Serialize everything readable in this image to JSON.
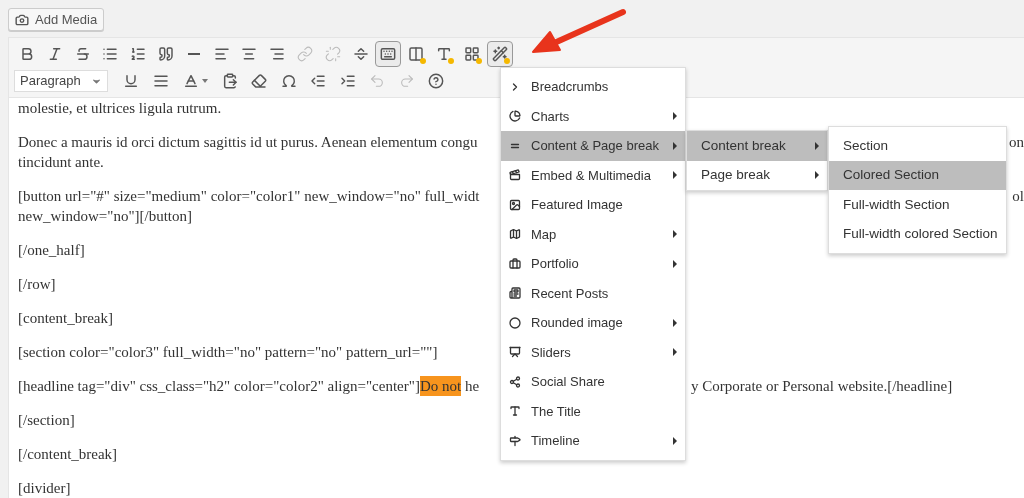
{
  "add_media": {
    "label": "Add Media"
  },
  "toolbar": {
    "row1": [
      {
        "pressed": false,
        "disabled": false
      },
      {
        "pressed": false,
        "disabled": false
      },
      {
        "pressed": false,
        "disabled": false
      },
      {
        "pressed": false,
        "disabled": false
      },
      {
        "pressed": false,
        "disabled": false
      },
      {
        "pressed": false,
        "disabled": false
      },
      {
        "pressed": false,
        "disabled": false
      },
      {
        "pressed": false,
        "disabled": false
      },
      {
        "pressed": false,
        "disabled": false
      },
      {
        "pressed": false,
        "disabled": false
      },
      {
        "pressed": false,
        "disabled": true
      },
      {
        "pressed": false,
        "disabled": true
      },
      {
        "pressed": false,
        "disabled": false
      },
      {
        "pressed": true,
        "disabled": false
      },
      {
        "pressed": false,
        "disabled": false
      },
      {
        "pressed": false,
        "disabled": false
      },
      {
        "pressed": false,
        "disabled": false
      },
      {
        "pressed": true,
        "disabled": false
      }
    ],
    "format_select": {
      "value": "Paragraph"
    },
    "row2": [
      {
        "pressed": false,
        "disabled": false
      },
      {
        "pressed": false,
        "disabled": false
      },
      {
        "pressed": false,
        "disabled": false
      },
      {
        "pressed": false,
        "disabled": false
      },
      {
        "pressed": false,
        "disabled": false
      },
      {
        "pressed": false,
        "disabled": false
      },
      {
        "pressed": false,
        "disabled": false
      },
      {
        "pressed": false,
        "disabled": false
      },
      {
        "pressed": false,
        "disabled": true
      },
      {
        "pressed": false,
        "disabled": true
      },
      {
        "pressed": false,
        "disabled": false
      }
    ]
  },
  "content": {
    "paragraphs": [
      {
        "lines": [
          {
            "text": "molestie, et ultrices ligula rutrum."
          }
        ]
      },
      {
        "lines": [
          {
            "text": "Donec a mauris id orci dictum sagittis id ut purus. Aenean elementum congu",
            "tail": "on"
          },
          {
            "text": "tincidunt ante."
          }
        ]
      },
      {
        "lines": [
          {
            "text": "[button url=\"#\" size=\"medium\" color=\"color1\" new_window=\"no\" full_widt",
            "tail": "ol"
          },
          {
            "text": "new_window=\"no\"][/button]"
          }
        ]
      },
      {
        "lines": [
          {
            "text": "[/one_half]"
          }
        ]
      },
      {
        "lines": [
          {
            "text": "[/row]"
          }
        ]
      },
      {
        "lines": [
          {
            "text": "[content_break]"
          }
        ]
      },
      {
        "lines": [
          {
            "text": "[section color=\"color3\" full_width=\"no\" pattern=\"no\" pattern_url=\"\"]"
          }
        ]
      },
      {
        "lines": [
          {
            "text": "[headline tag=\"div\" css_class=\"h2\" color=\"color2\" align=\"center\"]",
            "highlight": "Do not",
            "after": " he",
            "rest": "y Corporate or Personal website.[/headline]"
          }
        ]
      },
      {
        "lines": [
          {
            "text": "[/section]"
          }
        ]
      },
      {
        "lines": [
          {
            "text": "[/content_break]"
          }
        ]
      },
      {
        "lines": [
          {
            "text": "[divider]"
          }
        ]
      }
    ]
  },
  "menu": {
    "items": [
      {
        "label": "Breadcrumbs",
        "submenu": false,
        "selected": false
      },
      {
        "label": "Charts",
        "submenu": true,
        "selected": false
      },
      {
        "label": "Content & Page break",
        "submenu": true,
        "selected": true
      },
      {
        "label": "Embed & Multimedia",
        "submenu": true,
        "selected": false
      },
      {
        "label": "Featured Image",
        "submenu": false,
        "selected": false
      },
      {
        "label": "Map",
        "submenu": true,
        "selected": false
      },
      {
        "label": "Portfolio",
        "submenu": true,
        "selected": false
      },
      {
        "label": "Recent Posts",
        "submenu": false,
        "selected": false
      },
      {
        "label": "Rounded image",
        "submenu": true,
        "selected": false
      },
      {
        "label": "Sliders",
        "submenu": true,
        "selected": false
      },
      {
        "label": "Social Share",
        "submenu": false,
        "selected": false
      },
      {
        "label": "The Title",
        "submenu": false,
        "selected": false
      },
      {
        "label": "Timeline",
        "submenu": true,
        "selected": false
      }
    ]
  },
  "submenu": {
    "items": [
      {
        "label": "Content break",
        "submenu": true,
        "selected": true
      },
      {
        "label": "Page break",
        "submenu": true,
        "selected": false
      }
    ]
  },
  "submenu2": {
    "items": [
      {
        "label": "Section",
        "selected": false
      },
      {
        "label": "Colored Section",
        "selected": true
      },
      {
        "label": "Full-width Section",
        "selected": false
      },
      {
        "label": "Full-width colored Section",
        "selected": false
      }
    ]
  }
}
